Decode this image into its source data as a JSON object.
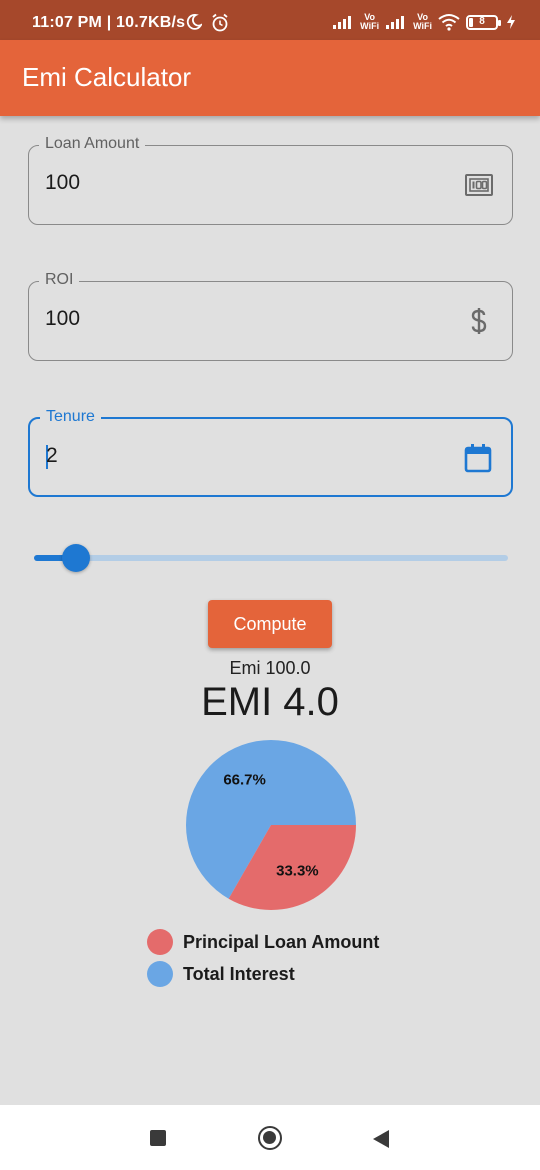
{
  "status_bar": {
    "time_speed": "11:07 PM | 10.7KB/s",
    "vo_label_1": "Vo",
    "wifi_label_1": "WiFi",
    "vo_label_2": "Vo",
    "wifi_label_2": "WiFi",
    "battery_level": "8",
    "icons": [
      "moon-icon",
      "alarm-icon",
      "signal-icon",
      "wifi-icon",
      "battery-icon",
      "charging-icon"
    ]
  },
  "app_bar": {
    "title": "Emi Calculator"
  },
  "form": {
    "loan_amount": {
      "label": "Loan Amount",
      "value": "100",
      "icon": "money-icon"
    },
    "roi": {
      "label": "ROI",
      "value": "100",
      "icon": "dollar-icon"
    },
    "tenure": {
      "label": "Tenure",
      "value": "2",
      "icon": "calendar-icon"
    }
  },
  "slider": {
    "value_fraction": 0.09
  },
  "compute_button": {
    "label": "Compute"
  },
  "result": {
    "emi_small": "Emi 100.0",
    "emi_big": "EMI 4.0"
  },
  "chart_data": {
    "type": "pie",
    "slices": [
      {
        "label": "Total Interest",
        "value": 66.7,
        "display": "66.7%",
        "color": "#6aa6e4"
      },
      {
        "label": "Principal Loan Amount",
        "value": 33.3,
        "display": "33.3%",
        "color": "#e46b6b"
      }
    ],
    "legend": [
      {
        "label": "Principal Loan Amount",
        "color": "#e46b6b"
      },
      {
        "label": "Total Interest",
        "color": "#6aa6e4"
      }
    ]
  },
  "colors": {
    "primary": "#e4643a",
    "status_bar": "#a6482b",
    "focus": "#1e78d2",
    "background": "#e0e0e0"
  }
}
